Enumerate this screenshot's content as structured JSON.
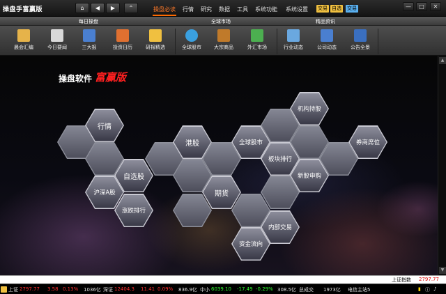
{
  "app": {
    "title": "操盘手富赢版"
  },
  "menu": [
    {
      "label": "操盘必读",
      "active": true
    },
    {
      "label": "行情"
    },
    {
      "label": "研究"
    },
    {
      "label": "数据"
    },
    {
      "label": "工具"
    },
    {
      "label": "系统功能"
    },
    {
      "label": "系统设置"
    }
  ],
  "badges": {
    "trade": "交易",
    "watchlist": "自选",
    "exchange": "交易"
  },
  "sections": {
    "daily": "每日操盘",
    "global": "全球市场",
    "premium": "精品资讯"
  },
  "toolbar": [
    {
      "label": "晨会汇编",
      "icon": "meeting-icon",
      "color": "#e6b34a"
    },
    {
      "label": "今日要闻",
      "icon": "news-icon",
      "color": "#d9d9d9"
    },
    {
      "label": "三大报",
      "icon": "newspaper-icon",
      "color": "#4a7fd0"
    },
    {
      "label": "投资日历",
      "icon": "calendar-icon",
      "color": "#e07030"
    },
    {
      "label": "研报精选",
      "icon": "report-icon",
      "color": "#f0c040"
    },
    {
      "label": "全球股市",
      "icon": "globe-icon",
      "color": "#3aa0e0"
    },
    {
      "label": "大宗商品",
      "icon": "commodity-icon",
      "color": "#c07a2a"
    },
    {
      "label": "外汇市场",
      "icon": "forex-icon",
      "color": "#4caf50"
    },
    {
      "label": "行业动态",
      "icon": "monitor-icon",
      "color": "#6aa8e0"
    },
    {
      "label": "公司动态",
      "icon": "company-icon",
      "color": "#4a7fd0"
    },
    {
      "label": "公告全景",
      "icon": "announcement-icon",
      "color": "#3a6fc0"
    }
  ],
  "brand": {
    "text": "操盘软件",
    "cursive": "富赢版"
  },
  "hexes": [
    {
      "label": "行情"
    },
    {
      "label": "自选股"
    },
    {
      "label": "沪深A股"
    },
    {
      "label": "涨跌排行"
    },
    {
      "label": "港股"
    },
    {
      "label": "期货"
    },
    {
      "label": "全球股市"
    },
    {
      "label": "板块排行"
    },
    {
      "label": "机构持股"
    },
    {
      "label": "新股申购"
    },
    {
      "label": "内部交易"
    },
    {
      "label": "资金流向"
    },
    {
      "label": "券商席位"
    }
  ],
  "status": {
    "index_label": "上证指数",
    "index_value": "2797.77"
  },
  "ticker": {
    "sh_label": "上证",
    "sh_value": "2797.77",
    "sh_change": "3.58",
    "sh_pct": "0.13%",
    "sh_amount": "1036亿",
    "sz_label": "深证",
    "sz_value": "12404.3",
    "sz_change": "11.41",
    "sz_pct": "0.09%",
    "sz_amount": "836.9亿",
    "zx_label": "中小",
    "zx_value": "6039.10",
    "zx_change": "-17.49",
    "zx_pct": "-0.29%",
    "zx_amount": "308.5亿",
    "total_label": "总成交",
    "total_value": "1973亿",
    "server": "电信主站5"
  }
}
